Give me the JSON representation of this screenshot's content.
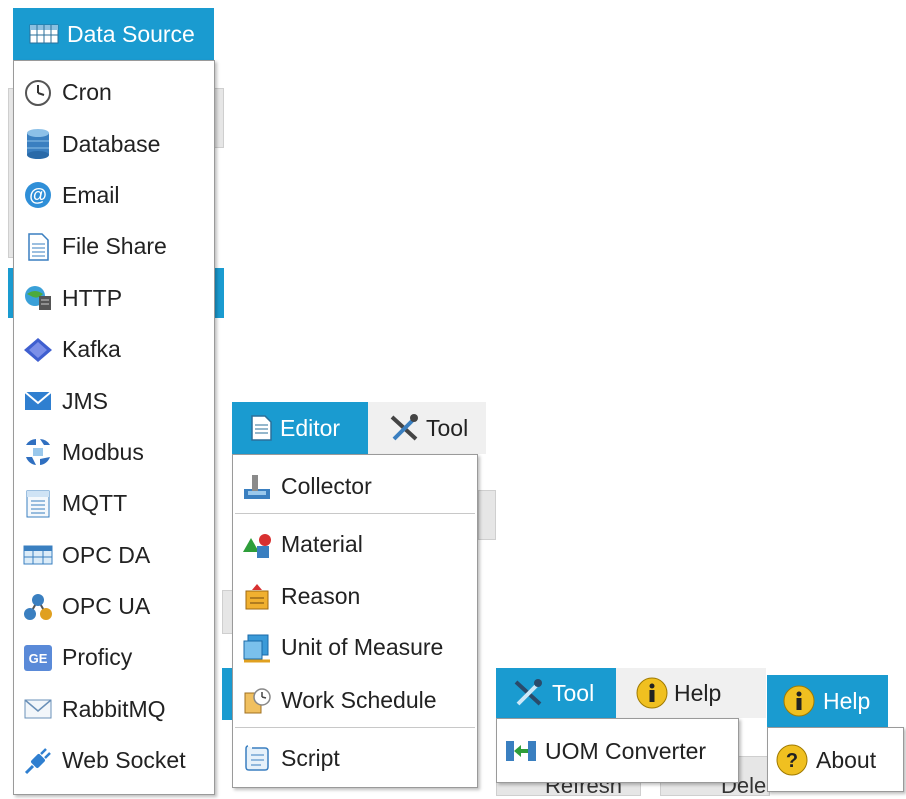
{
  "data_source": {
    "header_label": "Data Source",
    "items": [
      {
        "label": "Cron",
        "icon": "clock-icon"
      },
      {
        "label": "Database",
        "icon": "database-icon"
      },
      {
        "label": "Email",
        "icon": "at-sign-icon"
      },
      {
        "label": "File Share",
        "icon": "document-icon"
      },
      {
        "label": "HTTP",
        "icon": "globe-server-icon"
      },
      {
        "label": "Kafka",
        "icon": "kafka-icon"
      },
      {
        "label": "JMS",
        "icon": "envelope-icon"
      },
      {
        "label": "Modbus",
        "icon": "modbus-icon"
      },
      {
        "label": "MQTT",
        "icon": "mqtt-icon"
      },
      {
        "label": "OPC DA",
        "icon": "grid-icon"
      },
      {
        "label": "OPC UA",
        "icon": "molecule-icon"
      },
      {
        "label": "Proficy",
        "icon": "ge-icon"
      },
      {
        "label": "RabbitMQ",
        "icon": "mail-icon"
      },
      {
        "label": "Web Socket",
        "icon": "plug-icon"
      }
    ]
  },
  "editor": {
    "header_label": "Editor",
    "adjacent_tab_label": "Tool",
    "items": [
      {
        "label": "Collector",
        "icon": "collector-icon"
      },
      {
        "label": "Material",
        "icon": "material-icon"
      },
      {
        "label": "Reason",
        "icon": "reason-icon"
      },
      {
        "label": "Unit of Measure",
        "icon": "unit-of-measure-icon"
      },
      {
        "label": "Work Schedule",
        "icon": "work-schedule-icon"
      },
      {
        "label": "Script",
        "icon": "script-icon"
      }
    ]
  },
  "tool": {
    "header_label": "Tool",
    "adjacent_tab_label": "Help",
    "items": [
      {
        "label": "UOM Converter",
        "icon": "uom-converter-icon"
      }
    ]
  },
  "help": {
    "header_label": "Help",
    "items": [
      {
        "label": "About",
        "icon": "question-icon"
      }
    ]
  },
  "background": {
    "refresh_label": "Refresh",
    "delete_label": "Dele"
  },
  "colors": {
    "accent": "#1a9bd0",
    "menu_border": "#9a9a9a"
  }
}
